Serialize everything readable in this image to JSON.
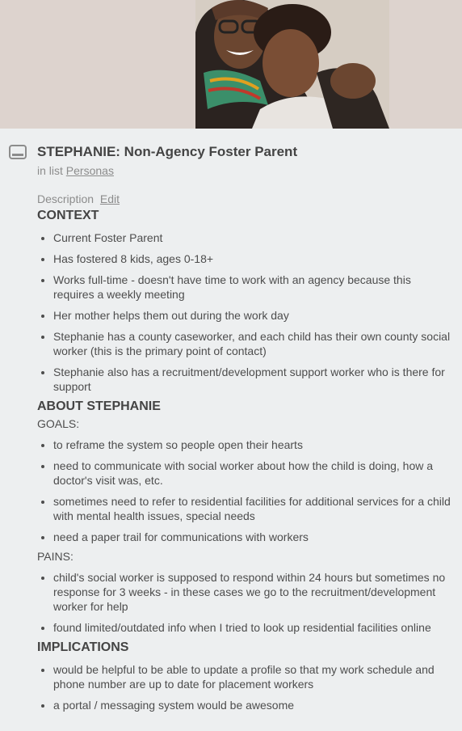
{
  "card": {
    "title": "STEPHANIE: Non-Agency Foster Parent",
    "in_list_prefix": "in list",
    "list_name": "Personas",
    "description_label": "Description",
    "edit_label": "Edit"
  },
  "icons": {
    "card": "card-icon"
  },
  "colors": {
    "background": "#edeff0",
    "cover": "#ddd3ce",
    "title": "#444444",
    "muted": "#8c8c8c"
  },
  "sections": {
    "context": {
      "heading": "CONTEXT",
      "items": [
        "Current Foster Parent",
        "Has fostered 8 kids, ages 0-18+",
        "Works full-time - doesn't have time to work with an agency because this requires a weekly meeting",
        "Her mother helps them out during the work day",
        "Stephanie has a county caseworker, and each child has their own county social worker (this is the primary point of contact)",
        "Stephanie also has a recruitment/development support worker who is there for support"
      ]
    },
    "about": {
      "heading": "ABOUT STEPHANIE",
      "goals_label": "GOALS:",
      "goals": [
        "to reframe the system so people open their hearts",
        "need to communicate with social worker about how the child is doing, how a doctor's visit was, etc.",
        "sometimes need to refer to residential facilities for additional services for a child with mental health issues, special needs",
        "need a paper trail for communications with workers"
      ],
      "pains_label": "PAINS:",
      "pains": [
        "child's social worker is supposed to respond within 24 hours but sometimes no response for 3 weeks - in these cases we go to the recruitment/development worker for help",
        "found limited/outdated info when I tried to look up residential facilities online"
      ]
    },
    "implications": {
      "heading": "IMPLICATIONS",
      "items": [
        "would be helpful to be able to update a profile so that my work schedule and phone number are up to date for placement workers",
        "a portal / messaging system would be awesome"
      ]
    }
  }
}
